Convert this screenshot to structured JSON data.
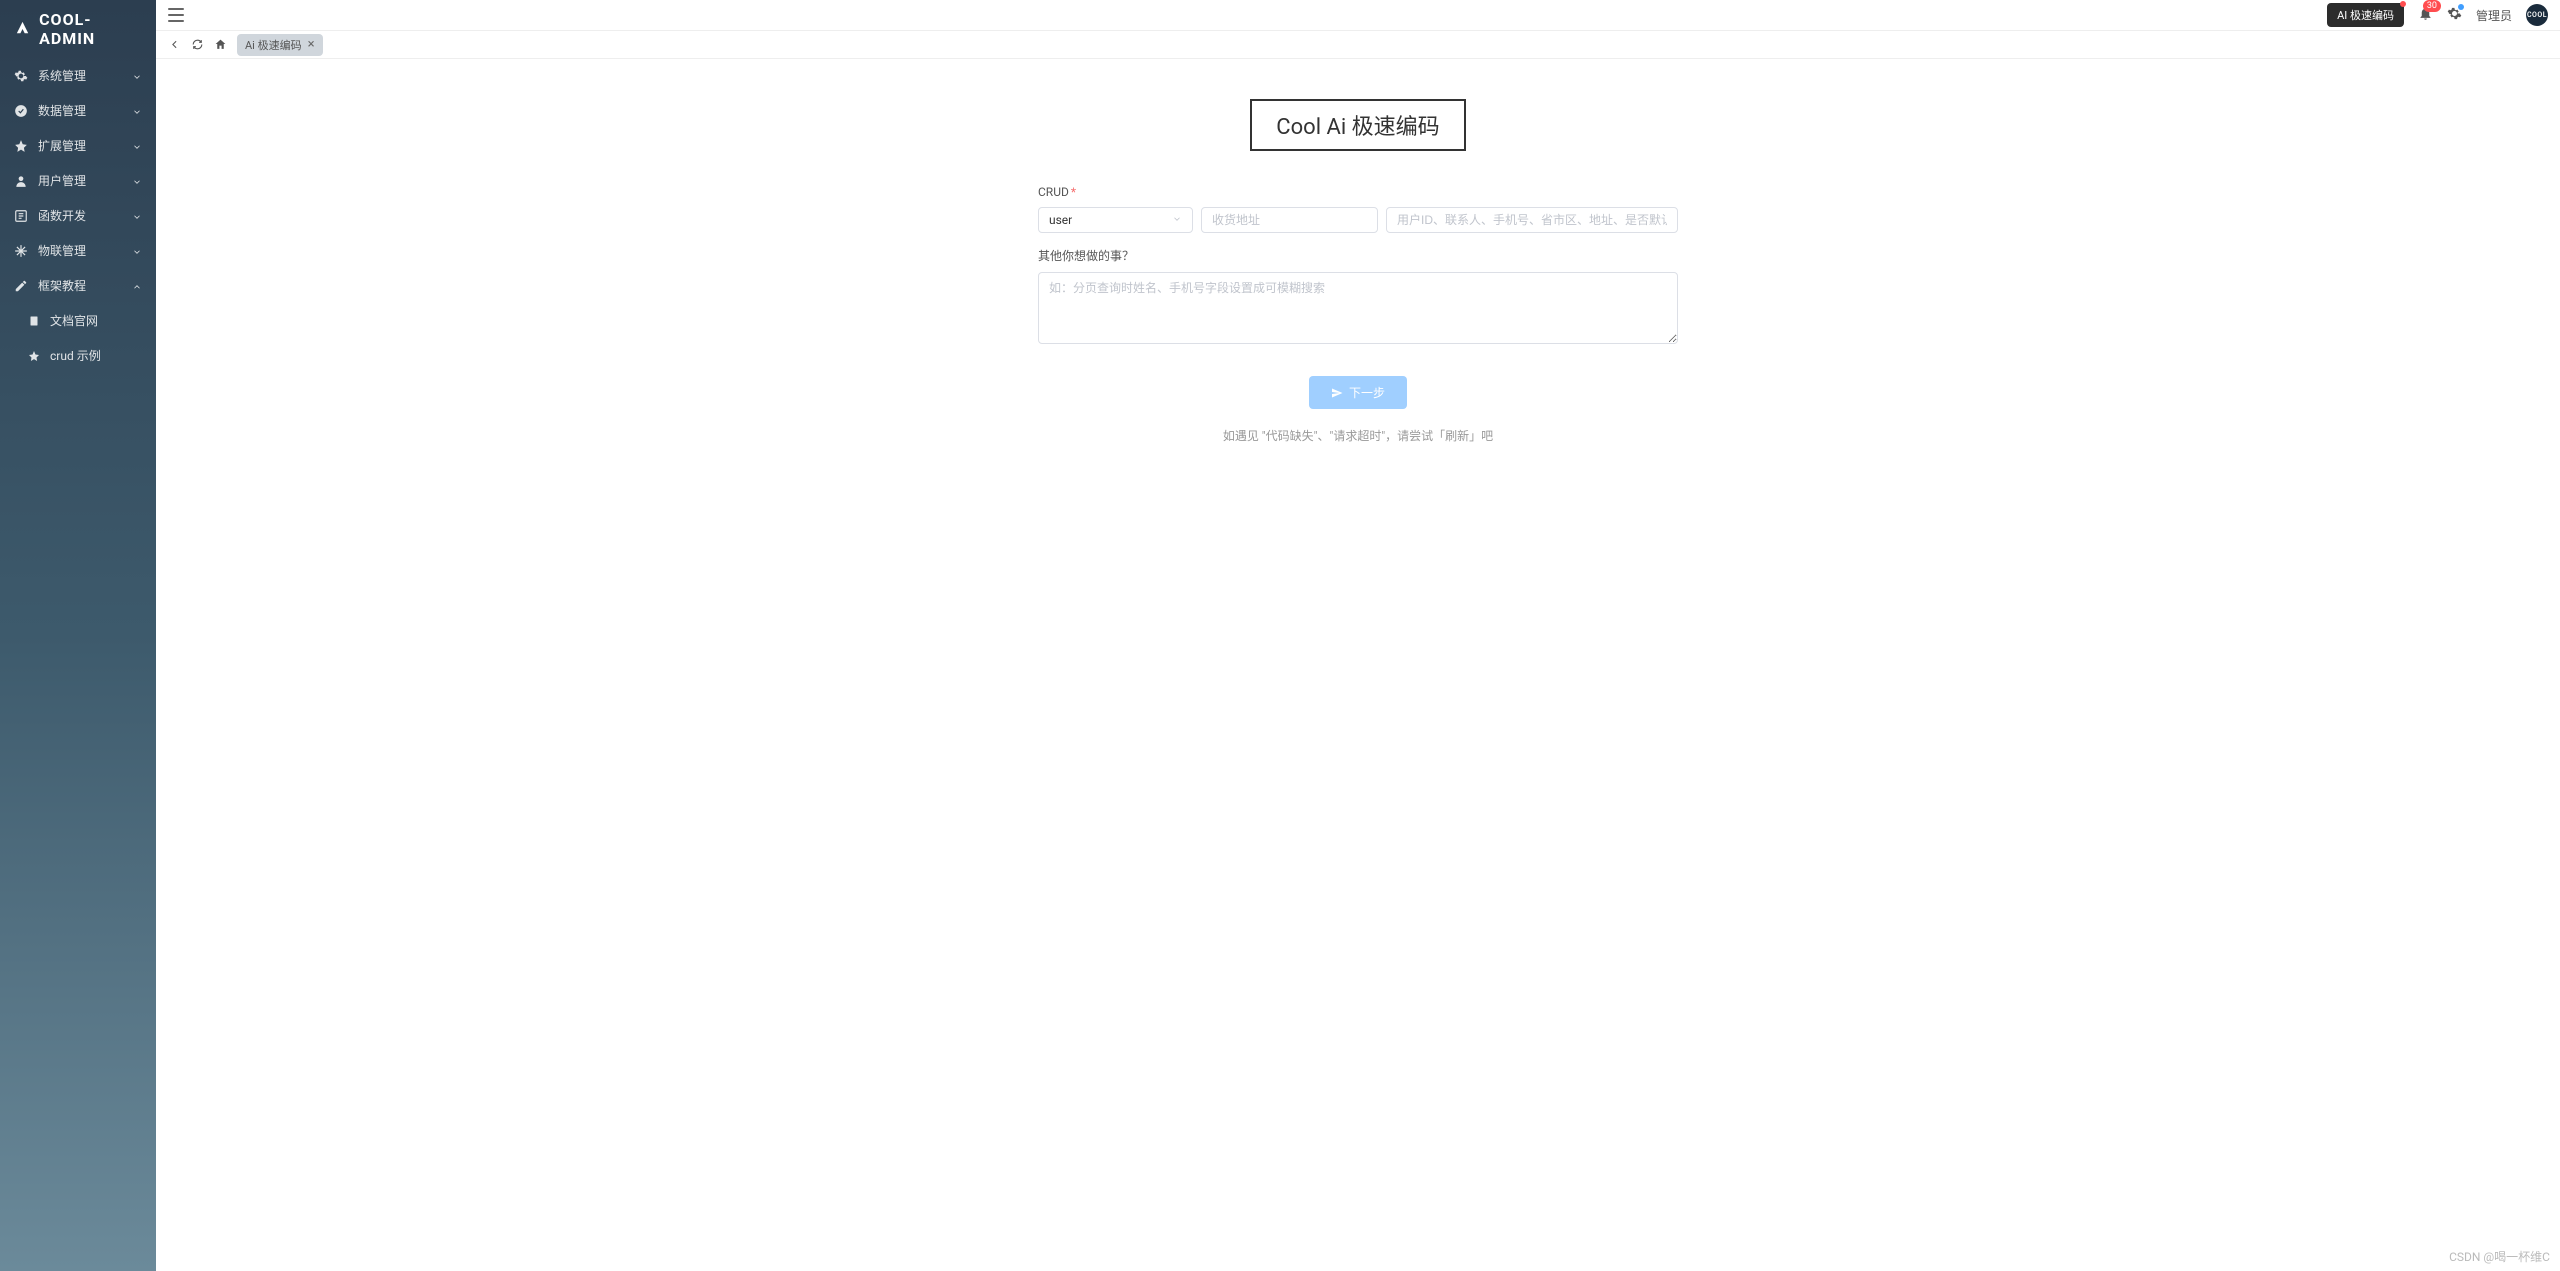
{
  "brand": "COOL-ADMIN",
  "topbar": {
    "ai_button": "AI 极速编码",
    "notification_count": "30",
    "username": "管理员",
    "avatar_text": "COOL"
  },
  "tab": {
    "label": "Ai 极速编码"
  },
  "sidebar": {
    "items": [
      {
        "label": "系统管理",
        "icon": "gear",
        "expanded": false
      },
      {
        "label": "数据管理",
        "icon": "check-circle",
        "expanded": false
      },
      {
        "label": "扩展管理",
        "icon": "star",
        "expanded": false
      },
      {
        "label": "用户管理",
        "icon": "user",
        "expanded": false
      },
      {
        "label": "函数开发",
        "icon": "function",
        "expanded": false
      },
      {
        "label": "物联管理",
        "icon": "snowflake",
        "expanded": false
      },
      {
        "label": "框架教程",
        "icon": "edit",
        "expanded": true,
        "children": [
          {
            "label": "文档官网",
            "icon": "doc"
          },
          {
            "label": "crud 示例",
            "icon": "star"
          }
        ]
      }
    ]
  },
  "page": {
    "title": "Cool Ai 极速编码",
    "crud_label": "CRUD",
    "select_value": "user",
    "input1_placeholder": "收货地址",
    "input2_placeholder": "用户ID、联系人、手机号、省市区、地址、是否默认",
    "other_label": "其他你想做的事？",
    "textarea_placeholder": "如：分页查询时姓名、手机号字段设置成可模糊搜索",
    "next_button": "下一步",
    "hint": "如遇见 \"代码缺失\"、\"请求超时\"，请尝试「刷新」吧"
  },
  "watermark": "CSDN @喝一杯维C"
}
